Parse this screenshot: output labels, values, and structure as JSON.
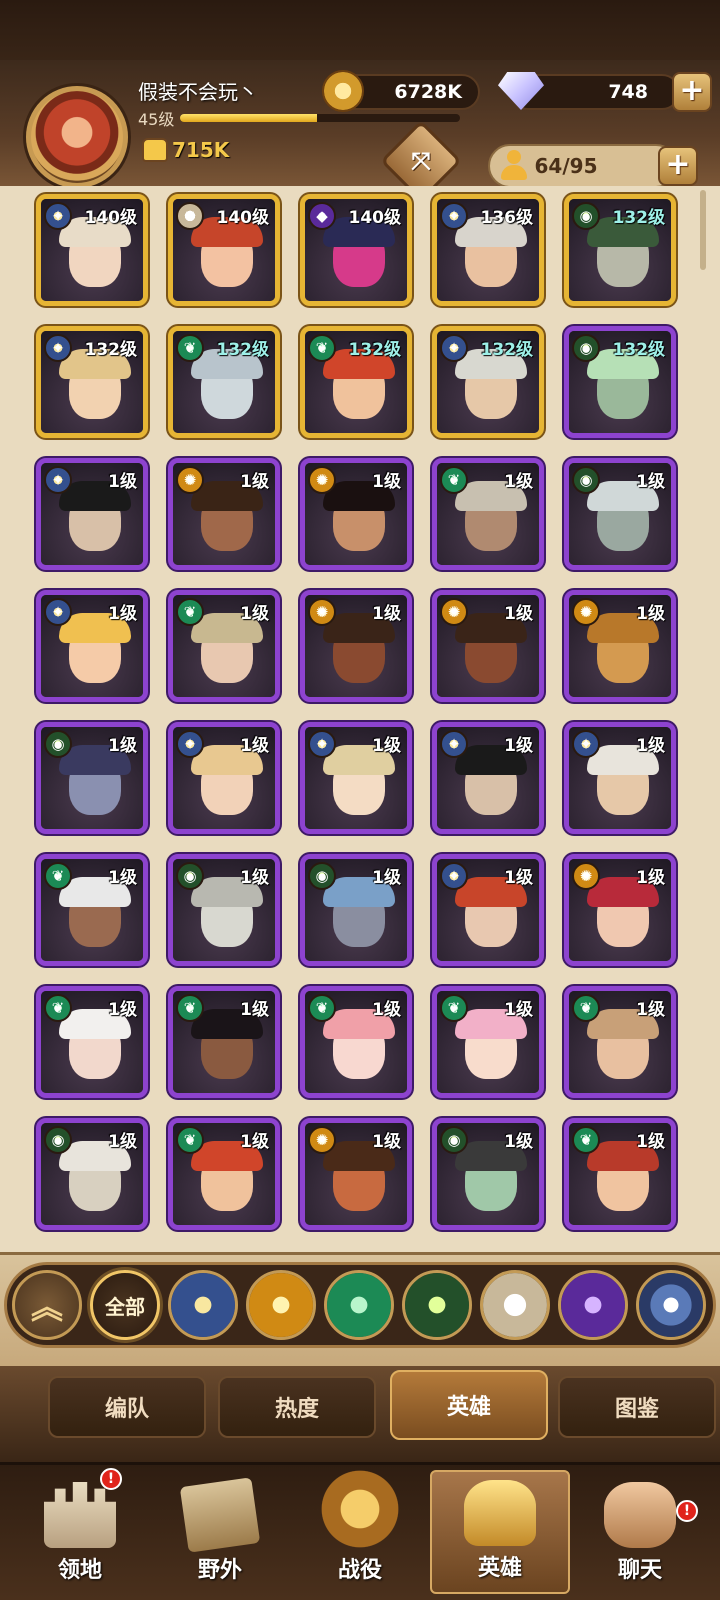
{
  "player": {
    "name": "假装不会玩丶",
    "level": "45级",
    "xp_fraction": 0.49,
    "power": "715K"
  },
  "currency": {
    "gold": "6728K",
    "gems": "748",
    "plus": "+"
  },
  "hero_capacity": "64/95",
  "heroes": [
    {
      "level": "140级",
      "frame": "gold",
      "faction": "light",
      "skin": "#f1d6c0",
      "hair": "#e8dcc8"
    },
    {
      "level": "140级",
      "frame": "gold",
      "faction": "star",
      "skin": "#f3c2a2",
      "hair": "#c6452a"
    },
    {
      "level": "140级",
      "frame": "gold",
      "faction": "dark",
      "skin": "#d63a8a",
      "hair": "#2a2a55"
    },
    {
      "level": "136级",
      "frame": "gold",
      "faction": "light",
      "skin": "#e9c1a0",
      "hair": "#d8d4cc"
    },
    {
      "level": "132级",
      "frame": "gold",
      "faction": "eye",
      "skin": "#b7b8a8",
      "hair": "#3a5a3a",
      "teal": true
    },
    {
      "level": "132级",
      "frame": "gold",
      "faction": "light",
      "skin": "#f2d2b0",
      "hair": "#e2c58a"
    },
    {
      "level": "132级",
      "frame": "gold",
      "faction": "nature",
      "skin": "#cfd8dc",
      "hair": "#b8c4cc",
      "teal": true
    },
    {
      "level": "132级",
      "frame": "gold",
      "faction": "nature",
      "skin": "#f0c29c",
      "hair": "#d0452a",
      "teal": true
    },
    {
      "level": "132级",
      "frame": "gold",
      "faction": "light",
      "skin": "#e6c8a8",
      "hair": "#d8d8d0",
      "teal": true
    },
    {
      "level": "132级",
      "frame": "purple",
      "faction": "eye",
      "skin": "#9ab89a",
      "hair": "#b6e0b6",
      "teal": true
    },
    {
      "level": "1级",
      "frame": "purple",
      "faction": "light",
      "skin": "#d8c0a8",
      "hair": "#1a1a1a"
    },
    {
      "level": "1级",
      "frame": "purple",
      "faction": "sun",
      "skin": "#a0684a",
      "hair": "#3a2416"
    },
    {
      "level": "1级",
      "frame": "purple",
      "faction": "sun",
      "skin": "#c8906a",
      "hair": "#1a1010"
    },
    {
      "level": "1级",
      "frame": "purple",
      "faction": "nature",
      "skin": "#b08a70",
      "hair": "#c8c0b0"
    },
    {
      "level": "1级",
      "frame": "purple",
      "faction": "eye",
      "skin": "#9aa8a0",
      "hair": "#d0d8d8"
    },
    {
      "level": "1级",
      "frame": "purple",
      "faction": "light",
      "skin": "#f5cba8",
      "hair": "#f0c050"
    },
    {
      "level": "1级",
      "frame": "purple",
      "faction": "nature",
      "skin": "#e8c8b0",
      "hair": "#c8b890"
    },
    {
      "level": "1级",
      "frame": "purple",
      "faction": "sun",
      "skin": "#8a4a30",
      "hair": "#3a2418"
    },
    {
      "level": "1级",
      "frame": "purple",
      "faction": "sun",
      "skin": "#8a4a30",
      "hair": "#3a2418"
    },
    {
      "level": "1级",
      "frame": "purple",
      "faction": "sun",
      "skin": "#d49a50",
      "hair": "#b8782a"
    },
    {
      "level": "1级",
      "frame": "purple",
      "faction": "eye",
      "skin": "#8a90b0",
      "hair": "#3a3a60"
    },
    {
      "level": "1级",
      "frame": "purple",
      "faction": "light",
      "skin": "#f2d2b8",
      "hair": "#e8c890"
    },
    {
      "level": "1级",
      "frame": "purple",
      "faction": "light",
      "skin": "#f4dcc4",
      "hair": "#e0cfa0"
    },
    {
      "level": "1级",
      "frame": "purple",
      "faction": "light",
      "skin": "#d8c0a8",
      "hair": "#1a1a1a"
    },
    {
      "level": "1级",
      "frame": "purple",
      "faction": "light",
      "skin": "#e6c8a8",
      "hair": "#e8e4dc"
    },
    {
      "level": "1级",
      "frame": "purple",
      "faction": "nature",
      "skin": "#9a6a50",
      "hair": "#e8e8e8"
    },
    {
      "level": "1级",
      "frame": "purple",
      "faction": "eye",
      "skin": "#d8d8d0",
      "hair": "#b8b8b0"
    },
    {
      "level": "1级",
      "frame": "purple",
      "faction": "eye",
      "skin": "#8a8ea0",
      "hair": "#7aa0c8"
    },
    {
      "level": "1级",
      "frame": "purple",
      "faction": "light",
      "skin": "#e8c8b0",
      "hair": "#c8452a"
    },
    {
      "level": "1级",
      "frame": "purple",
      "faction": "sun",
      "skin": "#f0c8b0",
      "hair": "#b82a3a"
    },
    {
      "level": "1级",
      "frame": "purple",
      "faction": "nature",
      "skin": "#f2d8cc",
      "hair": "#f2f0ee"
    },
    {
      "level": "1级",
      "frame": "purple",
      "faction": "nature",
      "skin": "#8a5a40",
      "hair": "#1a1418"
    },
    {
      "level": "1级",
      "frame": "purple",
      "faction": "nature",
      "skin": "#f8d8d0",
      "hair": "#f0a0a8"
    },
    {
      "level": "1级",
      "frame": "purple",
      "faction": "nature",
      "skin": "#f8dccc",
      "hair": "#f2b0c8"
    },
    {
      "level": "1级",
      "frame": "purple",
      "faction": "nature",
      "skin": "#e8c0a0",
      "hair": "#c8a078"
    },
    {
      "level": "1级",
      "frame": "purple",
      "faction": "eye",
      "skin": "#d8d0c0",
      "hair": "#e8e4dc"
    },
    {
      "level": "1级",
      "frame": "purple",
      "faction": "nature",
      "skin": "#f0c29c",
      "hair": "#d0452a"
    },
    {
      "level": "1级",
      "frame": "purple",
      "faction": "sun",
      "skin": "#c86a40",
      "hair": "#4a2a18"
    },
    {
      "level": "1级",
      "frame": "purple",
      "faction": "eye",
      "skin": "#a0c8a8",
      "hair": "#3a3a3a"
    },
    {
      "level": "1级",
      "frame": "purple",
      "faction": "nature",
      "skin": "#f0c4a0",
      "hair": "#b83a2a"
    }
  ],
  "filters": {
    "all": "全部"
  },
  "subtabs": [
    "编队",
    "热度",
    "英雄",
    "图鉴"
  ],
  "nav": [
    "领地",
    "野外",
    "战役",
    "英雄",
    "聊天"
  ],
  "badge_mark": "!"
}
